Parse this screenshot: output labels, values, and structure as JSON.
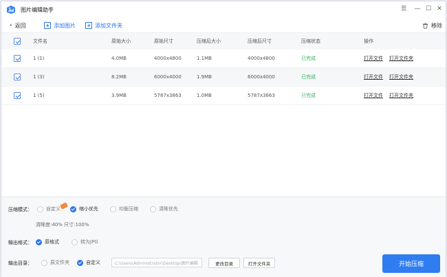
{
  "window": {
    "title": "图片编辑助手",
    "controls": [
      "☰",
      "—",
      "☐",
      "✕"
    ]
  },
  "toolbar": {
    "back_label": "返回",
    "add_image_label": "添加图片",
    "add_folder_label": "添加文件夹",
    "remove_label": "移除"
  },
  "table": {
    "headers": [
      "文件名",
      "原始大小",
      "原始尺寸",
      "压缩后大小",
      "压缩后尺寸",
      "压缩状态",
      "操作"
    ],
    "rows": [
      {
        "name": "1 (1)",
        "orig_size": "4.0MB",
        "orig_dim": "4000x4800",
        "comp_size": "1.1MB",
        "comp_dim": "4000x4800",
        "status": "已完成",
        "open_file": "打开文件",
        "open_folder": "打开文件夹"
      },
      {
        "name": "1 (3)",
        "orig_size": "8.2MB",
        "orig_dim": "6000x4000",
        "comp_size": "1.9MB",
        "comp_dim": "6000x4000",
        "status": "已完成",
        "open_file": "打开文件",
        "open_folder": "打开文件夹"
      },
      {
        "name": "1 (5)",
        "orig_size": "3.9MB",
        "orig_dim": "5787x3863",
        "comp_size": "1.0MB",
        "comp_dim": "5787x3863",
        "status": "已完成",
        "open_file": "打开文件",
        "open_folder": "打开文件夹"
      }
    ]
  },
  "settings": {
    "mode_label": "压缩模式：",
    "modes": [
      "自定义",
      "缩小优先",
      "均衡压缩",
      "清晰优先"
    ],
    "selected_mode": "缩小优先",
    "detail": "清晰度:40%   尺寸:100%",
    "format_label": "输出格式：",
    "formats": [
      "原格式",
      "转为JPG"
    ],
    "selected_format": "原格式",
    "dir_label": "输出目录：",
    "dirs": [
      "原文件夹",
      "自定义"
    ],
    "selected_dir": "自定义",
    "path": "C:\\Users\\Administrator\\Desktop\\图片编辑",
    "change_dir_label": "更改目录",
    "open_folder_label": "打开文件夹",
    "start_label": "开始压缩"
  },
  "colors": {
    "accent": "#2f7df0",
    "success": "#33b35e",
    "hot": "#f08a3c"
  }
}
